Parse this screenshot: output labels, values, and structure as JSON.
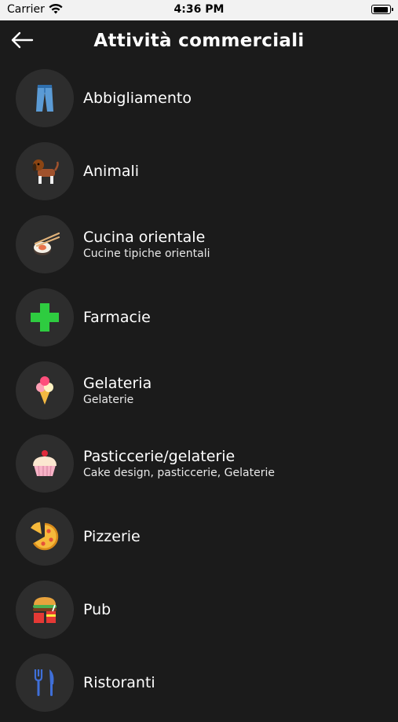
{
  "status_bar": {
    "carrier": "Carrier",
    "time": "4:36 PM"
  },
  "header": {
    "title": "Attività commerciali"
  },
  "categories": [
    {
      "title": "Abbigliamento",
      "subtitle": "",
      "icon": "jeans-icon"
    },
    {
      "title": "Animali",
      "subtitle": "",
      "icon": "dog-icon"
    },
    {
      "title": "Cucina orientale",
      "subtitle": "Cucine tipiche orientali",
      "icon": "sushi-chopsticks-icon"
    },
    {
      "title": "Farmacie",
      "subtitle": "",
      "icon": "pharmacy-cross-icon"
    },
    {
      "title": "Gelateria",
      "subtitle": "Gelaterie",
      "icon": "ice-cream-cone-icon"
    },
    {
      "title": "Pasticcerie/gelaterie",
      "subtitle": "Cake design, pasticcerie, Gelaterie",
      "icon": "cupcake-icon"
    },
    {
      "title": "Pizzerie",
      "subtitle": "",
      "icon": "pizza-icon"
    },
    {
      "title": "Pub",
      "subtitle": "",
      "icon": "burger-drink-icon"
    },
    {
      "title": "Ristoranti",
      "subtitle": "",
      "icon": "fork-knife-icon"
    }
  ]
}
